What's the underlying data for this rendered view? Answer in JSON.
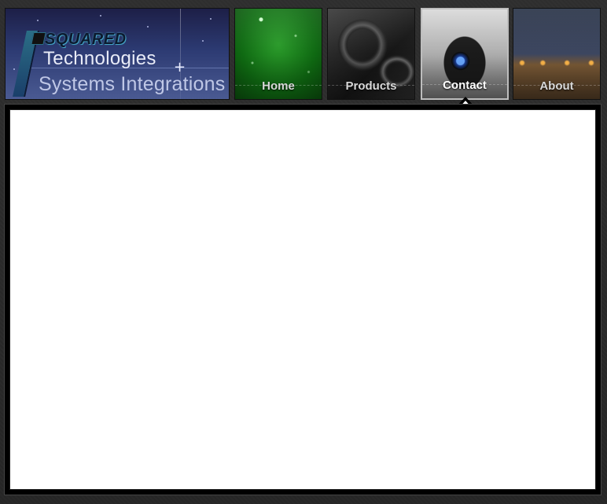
{
  "logo": {
    "brand": "SQUARED",
    "line1": "Technologies",
    "line2": "Systems Integrations"
  },
  "nav": {
    "active": "Contact",
    "items": [
      {
        "label": "Home"
      },
      {
        "label": "Products"
      },
      {
        "label": "Contact"
      },
      {
        "label": "About"
      }
    ]
  },
  "content": {
    "body": ""
  }
}
